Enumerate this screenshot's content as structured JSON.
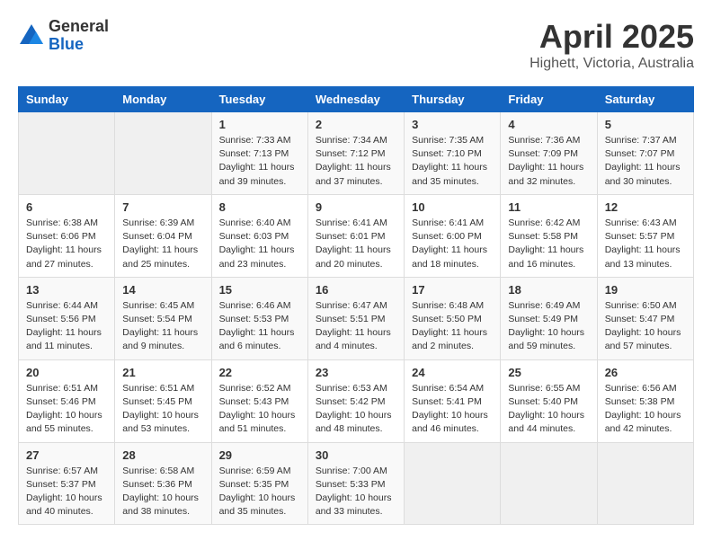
{
  "header": {
    "logo_general": "General",
    "logo_blue": "Blue",
    "title": "April 2025",
    "location": "Highett, Victoria, Australia"
  },
  "days_of_week": [
    "Sunday",
    "Monday",
    "Tuesday",
    "Wednesday",
    "Thursday",
    "Friday",
    "Saturday"
  ],
  "weeks": [
    [
      {
        "day": "",
        "info": ""
      },
      {
        "day": "",
        "info": ""
      },
      {
        "day": "1",
        "info": "Sunrise: 7:33 AM\nSunset: 7:13 PM\nDaylight: 11 hours and 39 minutes."
      },
      {
        "day": "2",
        "info": "Sunrise: 7:34 AM\nSunset: 7:12 PM\nDaylight: 11 hours and 37 minutes."
      },
      {
        "day": "3",
        "info": "Sunrise: 7:35 AM\nSunset: 7:10 PM\nDaylight: 11 hours and 35 minutes."
      },
      {
        "day": "4",
        "info": "Sunrise: 7:36 AM\nSunset: 7:09 PM\nDaylight: 11 hours and 32 minutes."
      },
      {
        "day": "5",
        "info": "Sunrise: 7:37 AM\nSunset: 7:07 PM\nDaylight: 11 hours and 30 minutes."
      }
    ],
    [
      {
        "day": "6",
        "info": "Sunrise: 6:38 AM\nSunset: 6:06 PM\nDaylight: 11 hours and 27 minutes."
      },
      {
        "day": "7",
        "info": "Sunrise: 6:39 AM\nSunset: 6:04 PM\nDaylight: 11 hours and 25 minutes."
      },
      {
        "day": "8",
        "info": "Sunrise: 6:40 AM\nSunset: 6:03 PM\nDaylight: 11 hours and 23 minutes."
      },
      {
        "day": "9",
        "info": "Sunrise: 6:41 AM\nSunset: 6:01 PM\nDaylight: 11 hours and 20 minutes."
      },
      {
        "day": "10",
        "info": "Sunrise: 6:41 AM\nSunset: 6:00 PM\nDaylight: 11 hours and 18 minutes."
      },
      {
        "day": "11",
        "info": "Sunrise: 6:42 AM\nSunset: 5:58 PM\nDaylight: 11 hours and 16 minutes."
      },
      {
        "day": "12",
        "info": "Sunrise: 6:43 AM\nSunset: 5:57 PM\nDaylight: 11 hours and 13 minutes."
      }
    ],
    [
      {
        "day": "13",
        "info": "Sunrise: 6:44 AM\nSunset: 5:56 PM\nDaylight: 11 hours and 11 minutes."
      },
      {
        "day": "14",
        "info": "Sunrise: 6:45 AM\nSunset: 5:54 PM\nDaylight: 11 hours and 9 minutes."
      },
      {
        "day": "15",
        "info": "Sunrise: 6:46 AM\nSunset: 5:53 PM\nDaylight: 11 hours and 6 minutes."
      },
      {
        "day": "16",
        "info": "Sunrise: 6:47 AM\nSunset: 5:51 PM\nDaylight: 11 hours and 4 minutes."
      },
      {
        "day": "17",
        "info": "Sunrise: 6:48 AM\nSunset: 5:50 PM\nDaylight: 11 hours and 2 minutes."
      },
      {
        "day": "18",
        "info": "Sunrise: 6:49 AM\nSunset: 5:49 PM\nDaylight: 10 hours and 59 minutes."
      },
      {
        "day": "19",
        "info": "Sunrise: 6:50 AM\nSunset: 5:47 PM\nDaylight: 10 hours and 57 minutes."
      }
    ],
    [
      {
        "day": "20",
        "info": "Sunrise: 6:51 AM\nSunset: 5:46 PM\nDaylight: 10 hours and 55 minutes."
      },
      {
        "day": "21",
        "info": "Sunrise: 6:51 AM\nSunset: 5:45 PM\nDaylight: 10 hours and 53 minutes."
      },
      {
        "day": "22",
        "info": "Sunrise: 6:52 AM\nSunset: 5:43 PM\nDaylight: 10 hours and 51 minutes."
      },
      {
        "day": "23",
        "info": "Sunrise: 6:53 AM\nSunset: 5:42 PM\nDaylight: 10 hours and 48 minutes."
      },
      {
        "day": "24",
        "info": "Sunrise: 6:54 AM\nSunset: 5:41 PM\nDaylight: 10 hours and 46 minutes."
      },
      {
        "day": "25",
        "info": "Sunrise: 6:55 AM\nSunset: 5:40 PM\nDaylight: 10 hours and 44 minutes."
      },
      {
        "day": "26",
        "info": "Sunrise: 6:56 AM\nSunset: 5:38 PM\nDaylight: 10 hours and 42 minutes."
      }
    ],
    [
      {
        "day": "27",
        "info": "Sunrise: 6:57 AM\nSunset: 5:37 PM\nDaylight: 10 hours and 40 minutes."
      },
      {
        "day": "28",
        "info": "Sunrise: 6:58 AM\nSunset: 5:36 PM\nDaylight: 10 hours and 38 minutes."
      },
      {
        "day": "29",
        "info": "Sunrise: 6:59 AM\nSunset: 5:35 PM\nDaylight: 10 hours and 35 minutes."
      },
      {
        "day": "30",
        "info": "Sunrise: 7:00 AM\nSunset: 5:33 PM\nDaylight: 10 hours and 33 minutes."
      },
      {
        "day": "",
        "info": ""
      },
      {
        "day": "",
        "info": ""
      },
      {
        "day": "",
        "info": ""
      }
    ]
  ]
}
